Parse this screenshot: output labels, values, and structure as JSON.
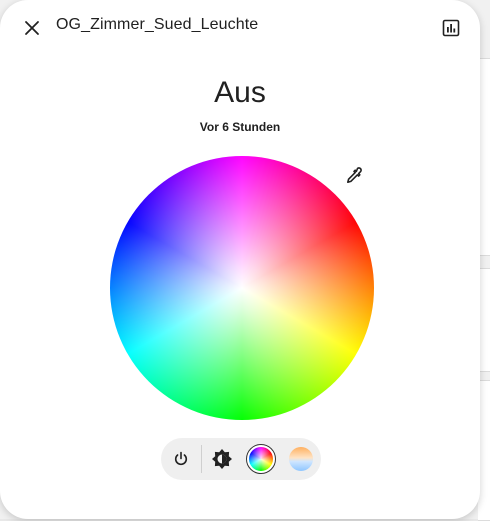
{
  "dialog": {
    "title": "OG_Zimmer_Sued_Leuchte",
    "state": "Aus",
    "last_changed": "Vor 6 Stunden"
  },
  "icons": {
    "close": "close-icon",
    "history": "chart-box-icon",
    "eyedropper": "eyedropper-icon",
    "power": "power-icon",
    "brightness": "brightness-icon",
    "color_wheel": "color-wheel-icon",
    "color_temp": "color-temperature-icon"
  },
  "controls": {
    "selected": "color"
  },
  "colors": {
    "text": "#212121",
    "control_bar": "#efefef"
  }
}
